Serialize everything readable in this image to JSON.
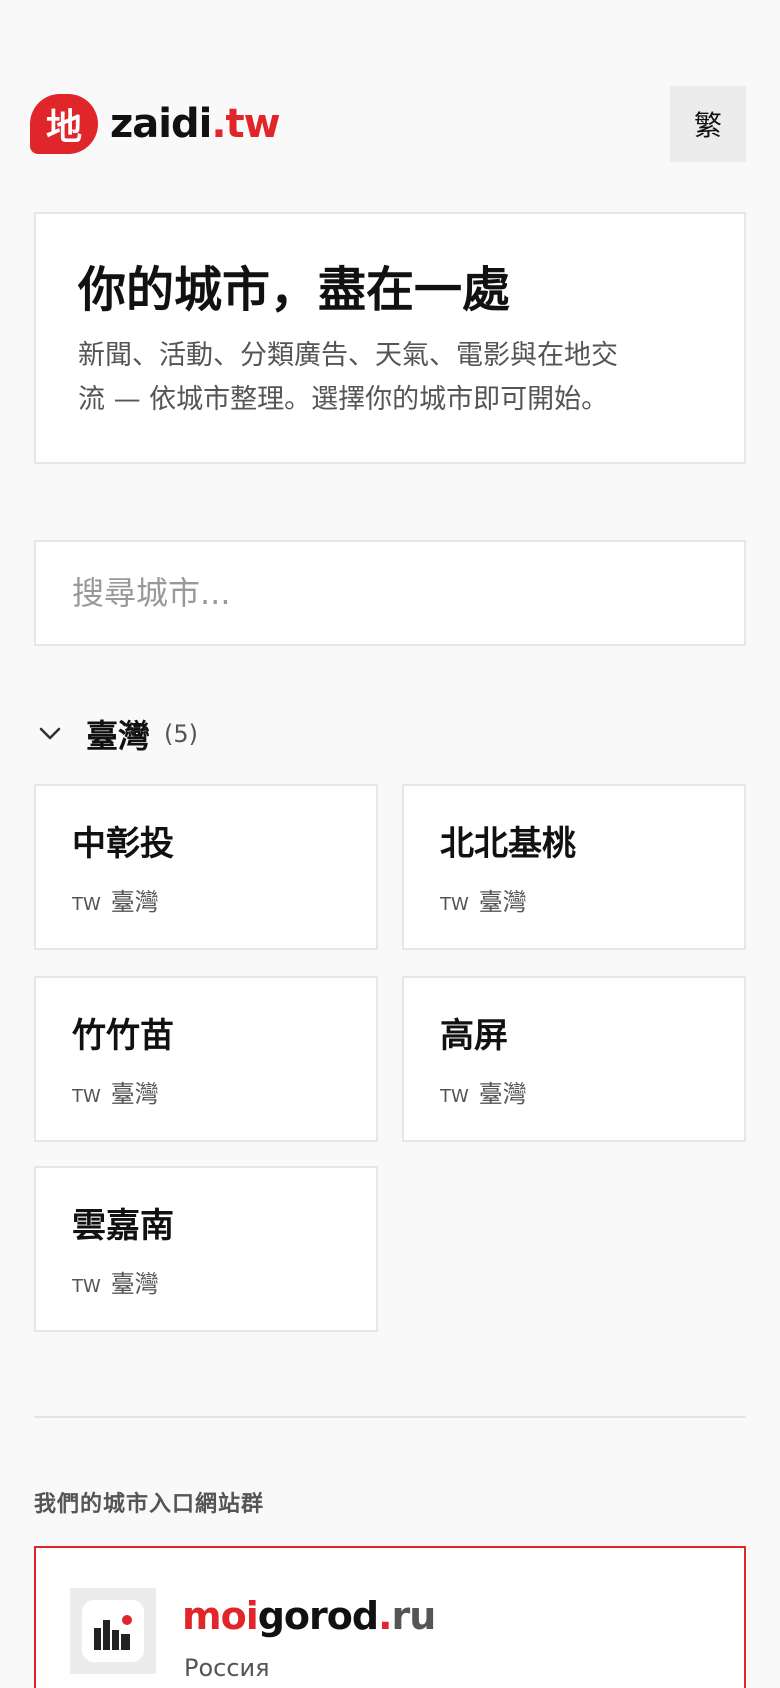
{
  "header": {
    "logo_mark": "地",
    "logo_name": "zaidi",
    "logo_tld": ".tw",
    "lang_button": "繁"
  },
  "hero": {
    "title": "你的城市，盡在一處",
    "line1": "新聞、活動、分類廣告、天氣、電影與在地交",
    "line2": "流 — 依城市整理。選擇你的城市即可開始。"
  },
  "search": {
    "placeholder": "搜尋城市..."
  },
  "region": {
    "name": "臺灣",
    "count": "(5)",
    "cities": [
      {
        "name": "中彰投",
        "code": "TW",
        "country": "臺灣"
      },
      {
        "name": "北北基桃",
        "code": "TW",
        "country": "臺灣"
      },
      {
        "name": "竹竹苗",
        "code": "TW",
        "country": "臺灣"
      },
      {
        "name": "高屏",
        "code": "TW",
        "country": "臺灣"
      },
      {
        "name": "雲嘉南",
        "code": "TW",
        "country": "臺灣"
      }
    ]
  },
  "network": {
    "title": "我們的城市入口網站群",
    "portals": [
      {
        "name_a": "moi",
        "name_b": "gorod",
        "dot": ".",
        "tld": "ru",
        "country": "Россия"
      }
    ]
  },
  "colors": {
    "brand": "#e0262b",
    "background": "#f9f9f9"
  },
  "icons": {
    "region_toggle": "chevron-down-icon",
    "portal_logo": "city-skyline-icon"
  }
}
